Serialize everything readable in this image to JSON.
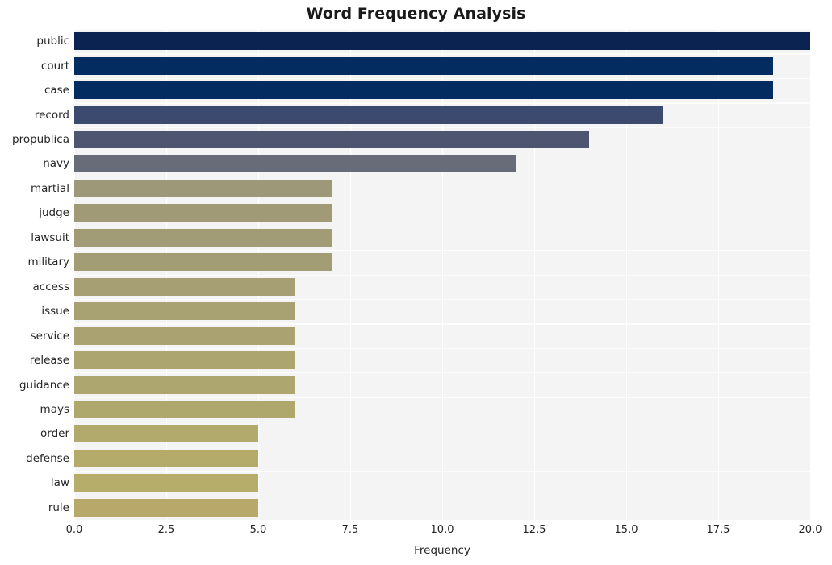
{
  "chart_data": {
    "type": "bar",
    "orientation": "horizontal",
    "title": "Word Frequency Analysis",
    "xlabel": "Frequency",
    "ylabel": "",
    "xlim": [
      0.0,
      20.0
    ],
    "xticks": [
      "0.0",
      "2.5",
      "5.0",
      "7.5",
      "10.0",
      "12.5",
      "15.0",
      "17.5",
      "20.0"
    ],
    "xtick_values": [
      0.0,
      2.5,
      5.0,
      7.5,
      10.0,
      12.5,
      15.0,
      17.5,
      20.0
    ],
    "grid": true,
    "legend": "none",
    "categories": [
      "public",
      "court",
      "case",
      "record",
      "propublica",
      "navy",
      "martial",
      "judge",
      "lawsuit",
      "military",
      "access",
      "issue",
      "service",
      "release",
      "guidance",
      "mays",
      "order",
      "defense",
      "law",
      "rule"
    ],
    "values": [
      20,
      19,
      19,
      16,
      14,
      12,
      7,
      7,
      7,
      7,
      6,
      6,
      6,
      6,
      6,
      6,
      5,
      5,
      5,
      5
    ],
    "bar_colors": [
      "#0a2350",
      "#032c61",
      "#032c61",
      "#3b4a6e",
      "#4e5570",
      "#676c78",
      "#9d9878",
      "#a09a77",
      "#a29c76",
      "#a39d75",
      "#a59f73",
      "#a8a172",
      "#aaa371",
      "#aca56f",
      "#ada66e",
      "#afa86d",
      "#b2aa6c",
      "#b4ab6b",
      "#b6ad6a",
      "#b8a96a"
    ],
    "plot_bgcolor": "#f4f4f5",
    "figure_bgcolor": "#ffffff",
    "gridline_color": "#ffffff",
    "text_color": "#262626"
  }
}
